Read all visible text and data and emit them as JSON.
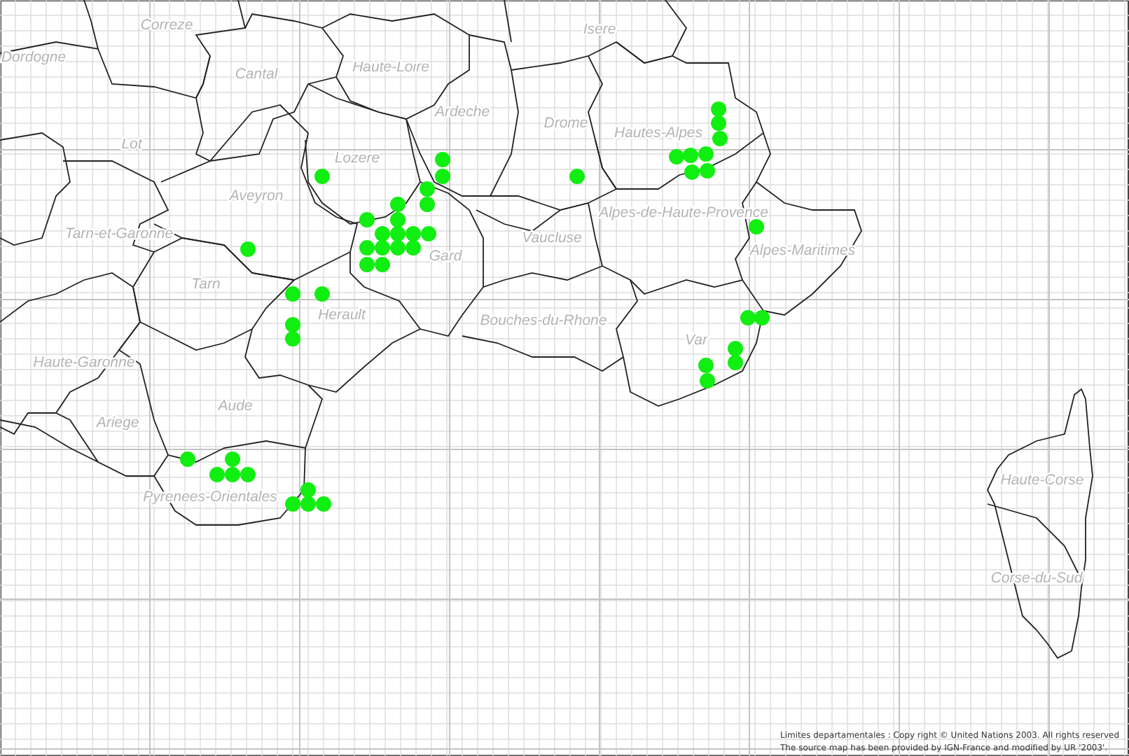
{
  "map": {
    "department_labels": [
      "Correze",
      "Dordogne",
      "Haute-Loire",
      "Cantal",
      "Isere",
      "Ardeche",
      "Drome",
      "Lot",
      "Lozere",
      "Hautes-Alpes",
      "Aveyron",
      "Alpes-de-Haute-Provence",
      "Tarn-et-Garonne",
      "Gard",
      "Vaucluse",
      "Alpes-Maritimes",
      "Tarn",
      "Herault",
      "Bouches-du-Rhone",
      "Var",
      "Haute-Garonne",
      "Aude",
      "Ariege",
      "Pyrenees-Orientales",
      "Haute-Corse",
      "Corse-du-Sud"
    ]
  },
  "copyright": [
    "Limites departamentales : Copy right © United Nations 2003. All rights reserved",
    "The source map has been provided by IGN-France and modified by UR '2003'."
  ]
}
